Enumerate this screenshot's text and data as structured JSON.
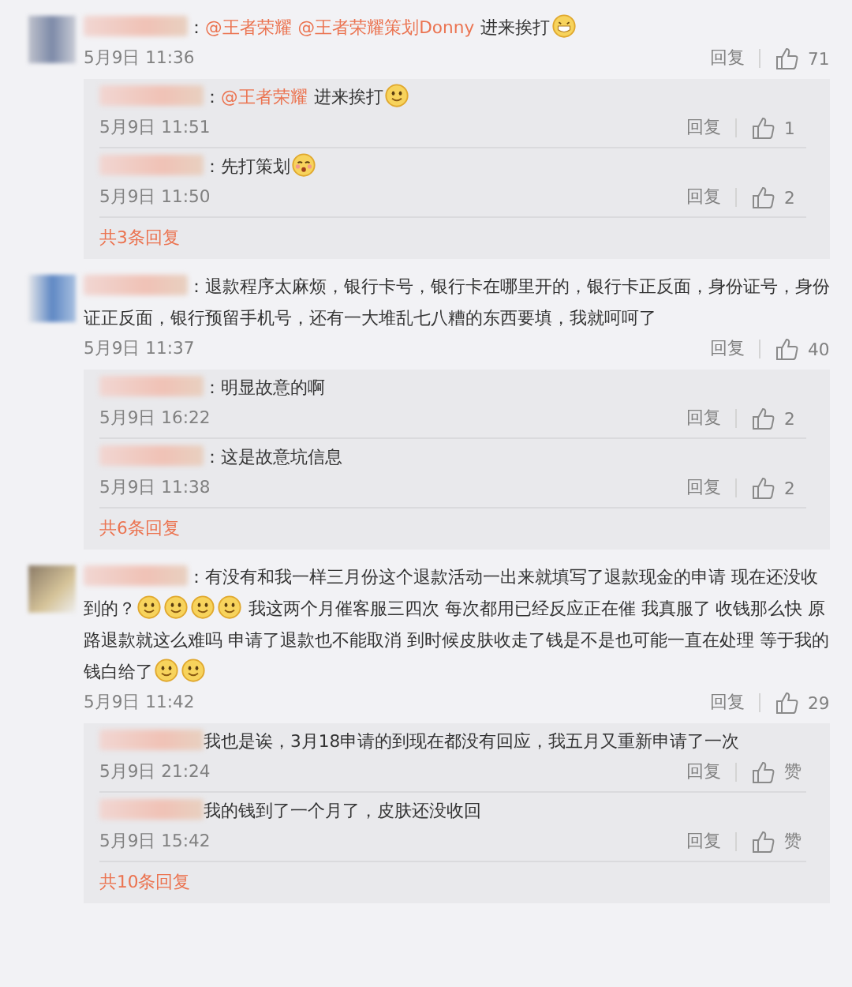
{
  "comments": [
    {
      "segments": [
        {
          "kind": "text",
          "text": "："
        },
        {
          "kind": "mention",
          "text": "@王者荣耀"
        },
        {
          "kind": "mention",
          "text": "@王者荣耀策划Donny"
        },
        {
          "kind": "text",
          "text": "进来挨打"
        },
        {
          "kind": "grin"
        }
      ],
      "time": "5月9日 11:36",
      "reply": "回复",
      "likes": "71",
      "replies": [
        {
          "segments": [
            {
              "kind": "text",
              "text": "："
            },
            {
              "kind": "mention",
              "text": "@王者荣耀"
            },
            {
              "kind": "text",
              "text": "进来挨打"
            },
            {
              "kind": "smile"
            }
          ],
          "time": "5月9日 11:51",
          "reply": "回复",
          "likes": "1"
        },
        {
          "segments": [
            {
              "kind": "text",
              "text": "：先打策划"
            },
            {
              "kind": "shy"
            }
          ],
          "time": "5月9日 11:50",
          "reply": "回复",
          "likes": "2"
        }
      ],
      "more": "共3条回复"
    },
    {
      "segments": [
        {
          "kind": "text",
          "text": "：退款程序太麻烦，银行卡号，银行卡在哪里开的，银行卡正反面，身份证号，身份证正反面，银行预留手机号，还有一大堆乱七八糟的东西要填，我就呵呵了"
        }
      ],
      "time": "5月9日 11:37",
      "reply": "回复",
      "likes": "40",
      "replies": [
        {
          "segments": [
            {
              "kind": "text",
              "text": "：明显故意的啊"
            }
          ],
          "time": "5月9日 16:22",
          "reply": "回复",
          "likes": "2"
        },
        {
          "segments": [
            {
              "kind": "text",
              "text": "：这是故意坑信息"
            }
          ],
          "time": "5月9日 11:38",
          "reply": "回复",
          "likes": "2"
        }
      ],
      "more": "共6条回复"
    },
    {
      "segments": [
        {
          "kind": "text",
          "text": "：有没有和我一样三月份这个退款活动一出来就填写了退款现金的申请 现在还没收到的？"
        },
        {
          "kind": "smile"
        },
        {
          "kind": "smile"
        },
        {
          "kind": "smile"
        },
        {
          "kind": "smile"
        },
        {
          "kind": "text",
          "text": " 我这两个月催客服三四次 每次都用已经反应正在催 我真服了 收钱那么快 原路退款就这么难吗 申请了退款也不能取消 到时候皮肤收走了钱是不是也可能一直在处理 等于我的钱白给了"
        },
        {
          "kind": "smile"
        },
        {
          "kind": "smile"
        }
      ],
      "time": "5月9日 11:42",
      "reply": "回复",
      "likes": "29",
      "replies": [
        {
          "segments": [
            {
              "kind": "text",
              "text": "我也是诶，3月18申请的到现在都没有回应，我五月又重新申请了一次"
            }
          ],
          "time": "5月9日 21:24",
          "reply": "回复",
          "likes": "赞"
        },
        {
          "segments": [
            {
              "kind": "text",
              "text": "我的钱到了一个月了，皮肤还没收回"
            }
          ],
          "time": "5月9日 15:42",
          "reply": "回复",
          "likes": "赞"
        }
      ],
      "more": "共10条回复"
    }
  ]
}
